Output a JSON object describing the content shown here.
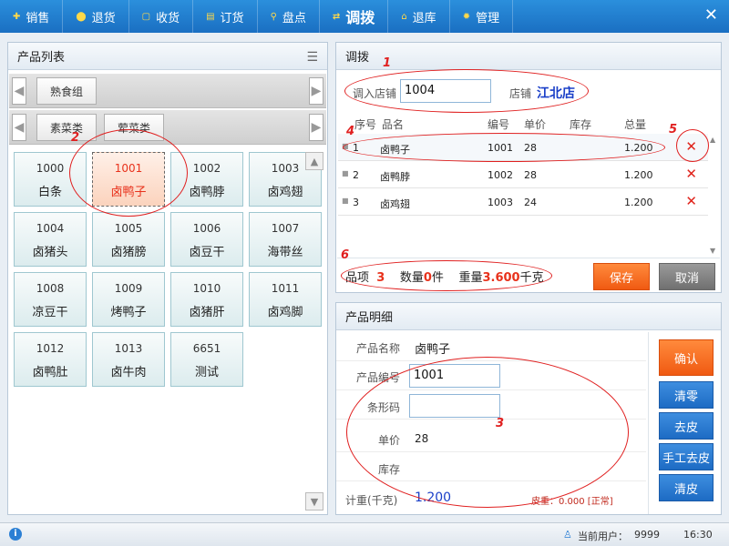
{
  "nav": {
    "items": [
      {
        "label": "销售"
      },
      {
        "label": "退货"
      },
      {
        "label": "收货"
      },
      {
        "label": "订货"
      },
      {
        "label": "盘点"
      },
      {
        "label": "调拨"
      },
      {
        "label": "退库"
      },
      {
        "label": "管理"
      }
    ],
    "active": "调拨",
    "close_icon": "close-icon"
  },
  "product_list": {
    "title": "产品列表",
    "category_row1": [
      "熟食组"
    ],
    "category_row2": [
      "素菜类",
      "荤菜类"
    ],
    "products": [
      {
        "code": "1000",
        "name": "白条"
      },
      {
        "code": "1001",
        "name": "卤鸭子",
        "selected": true
      },
      {
        "code": "1002",
        "name": "卤鸭脖"
      },
      {
        "code": "1003",
        "name": "卤鸡翅"
      },
      {
        "code": "1004",
        "name": "卤猪头"
      },
      {
        "code": "1005",
        "name": "卤猪膀"
      },
      {
        "code": "1006",
        "name": "卤豆干"
      },
      {
        "code": "1007",
        "name": "海带丝"
      },
      {
        "code": "1008",
        "name": "凉豆干"
      },
      {
        "code": "1009",
        "name": "烤鸭子"
      },
      {
        "code": "1010",
        "name": "卤猪肝"
      },
      {
        "code": "1011",
        "name": "卤鸡脚"
      },
      {
        "code": "1012",
        "name": "卤鸭肚"
      },
      {
        "code": "1013",
        "name": "卤牛肉"
      },
      {
        "code": "6651",
        "name": "测试"
      }
    ]
  },
  "transfer": {
    "title": "调拨",
    "store_in_label": "调入店铺",
    "store_in_value": "1004",
    "store_label": "店铺",
    "store_name": "江北店",
    "columns": [
      "序号",
      "品名",
      "编号",
      "单价",
      "库存",
      "总量"
    ],
    "rows": [
      {
        "no": "1",
        "name": "卤鸭子",
        "code": "1001",
        "price": "28",
        "stock": "",
        "total": "1.200"
      },
      {
        "no": "2",
        "name": "卤鸭脖",
        "code": "1002",
        "price": "28",
        "stock": "",
        "total": "1.200"
      },
      {
        "no": "3",
        "name": "卤鸡翅",
        "code": "1003",
        "price": "24",
        "stock": "",
        "total": "1.200"
      }
    ],
    "summary": {
      "items_label": "品项",
      "items_value": "3",
      "qty_label": "数量",
      "qty_value": "0",
      "qty_unit": "件",
      "weight_label": "重量",
      "weight_value": "3.600",
      "weight_unit": "千克"
    },
    "save_label": "保存",
    "cancel_label": "取消"
  },
  "detail": {
    "title": "产品明细",
    "name_label": "产品名称",
    "name_value": "卤鸭子",
    "code_label": "产品编号",
    "code_value": "1001",
    "barcode_label": "条形码",
    "barcode_value": "",
    "price_label": "单价",
    "price_value": "28",
    "stock_label": "库存",
    "stock_value": "",
    "weight_label": "计重(千克)",
    "weight_value": "1.200",
    "tare_text": "皮重：0.000 [正常]",
    "buttons": {
      "confirm": "确认",
      "zero": "清零",
      "tare": "去皮",
      "manual_tare": "手工去皮",
      "clear": "清皮"
    }
  },
  "annotations": [
    "1",
    "2",
    "3",
    "4",
    "5",
    "6"
  ],
  "status": {
    "user_label": "当前用户：",
    "user_value": "9999",
    "time": "16:30"
  },
  "colors": {
    "nav_blue": "#1a6fc2",
    "accent_red": "#e8321c",
    "save_orange": "#f05a12",
    "store_name_blue": "#1a3fc8"
  }
}
